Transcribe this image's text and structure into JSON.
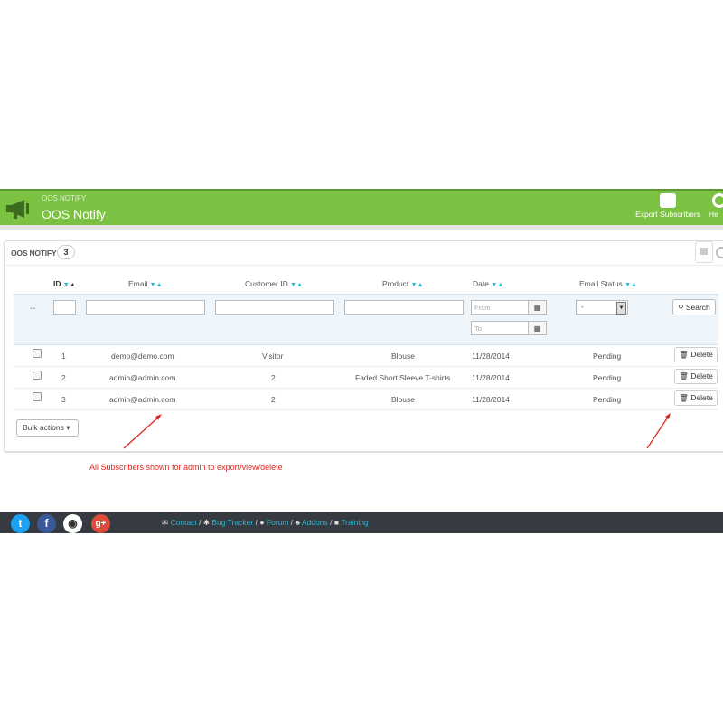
{
  "header": {
    "breadcrumb": "OOS NOTIFY",
    "title": "OOS Notify",
    "export_label": "Export Subscribers",
    "help_label": "He",
    "bg_color": "#7cc242"
  },
  "panel": {
    "title": "OOS NOTIFY",
    "count": "3"
  },
  "columns": {
    "id": "ID",
    "email": "Email",
    "customer_id": "Customer ID",
    "product": "Product",
    "date": "Date",
    "email_status": "Email Status"
  },
  "filters": {
    "dash": "--",
    "date_from_placeholder": "From",
    "date_to_placeholder": "To",
    "status_value": "-",
    "search_label": "Search"
  },
  "rows": [
    {
      "id": "1",
      "email": "demo@demo.com",
      "customer_id": "Visitor",
      "product": "Blouse",
      "date": "11/28/2014",
      "status": "Pending",
      "action": "Delete"
    },
    {
      "id": "2",
      "email": "admin@admin.com",
      "customer_id": "2",
      "product": "Faded Short Sleeve T-shirts",
      "date": "11/28/2014",
      "status": "Pending",
      "action": "Delete"
    },
    {
      "id": "3",
      "email": "admin@admin.com",
      "customer_id": "2",
      "product": "Blouse",
      "date": "11/28/2014",
      "status": "Pending",
      "action": "Delete"
    }
  ],
  "bulk_actions": "Bulk actions",
  "annotation": "All Subscribers shown for admin to export/view/delete",
  "footer": {
    "social": [
      {
        "name": "twitter-icon",
        "glyph": "t",
        "color": "#1da1f2"
      },
      {
        "name": "facebook-icon",
        "glyph": "f",
        "color": "#3b5998"
      },
      {
        "name": "github-icon",
        "glyph": "◉",
        "color": "#333333"
      },
      {
        "name": "googleplus-icon",
        "glyph": "g+",
        "color": "#dd4b39"
      }
    ],
    "links": [
      "Contact",
      "Bug Tracker",
      "Forum",
      "Addons",
      "Training"
    ]
  }
}
